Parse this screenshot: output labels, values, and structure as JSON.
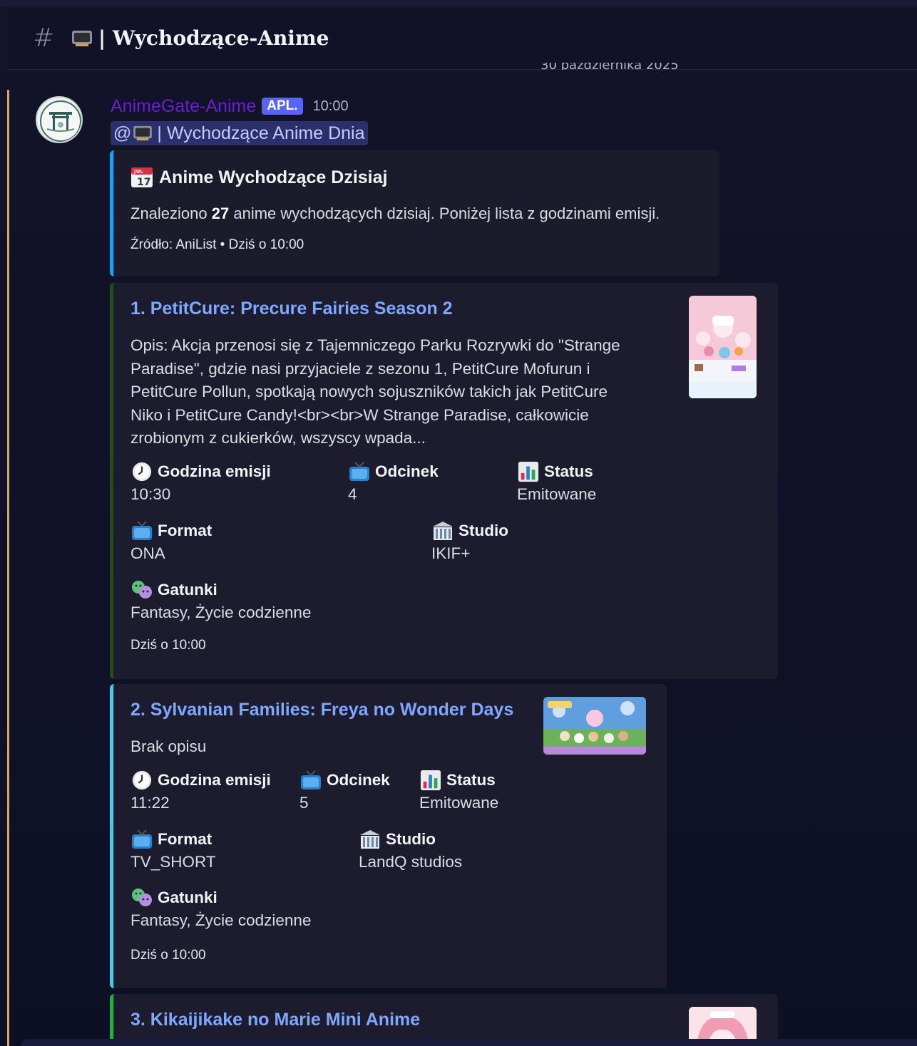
{
  "channel": {
    "hash": "#",
    "icon": "tv-icon",
    "name": "| Wychodzące-Anime"
  },
  "date_divider": "30 października 2025",
  "message": {
    "author": "AnimeGate-Anime",
    "badge": "APL.",
    "time": "10:00",
    "mention": "| Wychodzące Anime Dnia",
    "mention_prefix": "@"
  },
  "summary": {
    "title": "Anime Wychodzące Dzisiaj",
    "desc_pre": "Znaleziono ",
    "count": "27",
    "desc_post": " anime wychodzących dzisiaj. Poniżej lista z godzinami emisji.",
    "footer": "Źródło: AniList • Dziś o 10:00"
  },
  "labels": {
    "air": "Godzina emisji",
    "episode": "Odcinek",
    "status": "Status",
    "format": "Format",
    "studio": "Studio",
    "genres": "Gatunki"
  },
  "anime": [
    {
      "title": "1. PetitCure: Precure Fairies Season 2",
      "desc_lines": [
        "Opis: Akcja przenosi się z Tajemniczego Parku Rozrywki do \"Strange",
        "Paradise\", gdzie nasi przyjaciele z sezonu 1, PetitCure Mofurun i",
        "PetitCure Pollun, spotkają nowych sojuszników takich jak PetitCure",
        "Niko i PetitCure Candy!<br><br>W Strange Paradise, całkowicie",
        "zrobionym z cukierków, wszyscy wpada..."
      ],
      "air": "10:30",
      "episode": "4",
      "status": "Emitowane",
      "format": "ONA",
      "studio": "IKIF+",
      "genres": "Fantasy, Życie codzienne",
      "footer": "Dziś o 10:00",
      "accent": "#2b4a24"
    },
    {
      "title": "2. Sylvanian Families: Freya no Wonder Days",
      "desc_lines": [
        "Brak opisu"
      ],
      "air": "11:22",
      "episode": "5",
      "status": "Emitowane",
      "format": "TV_SHORT",
      "studio": "LandQ studios",
      "genres": "Fantasy, Życie codzienne",
      "footer": "Dziś o 10:00",
      "accent": "#55c6e0"
    },
    {
      "title": "3. Kikaijikake no Marie Mini Anime",
      "accent": "#2aa84a"
    }
  ],
  "colors": {
    "link": "#7fa7ff",
    "author": "#6a1fd1",
    "badge": "#5865f2",
    "summary_accent": "#1da1f2",
    "background": "#14142a"
  }
}
